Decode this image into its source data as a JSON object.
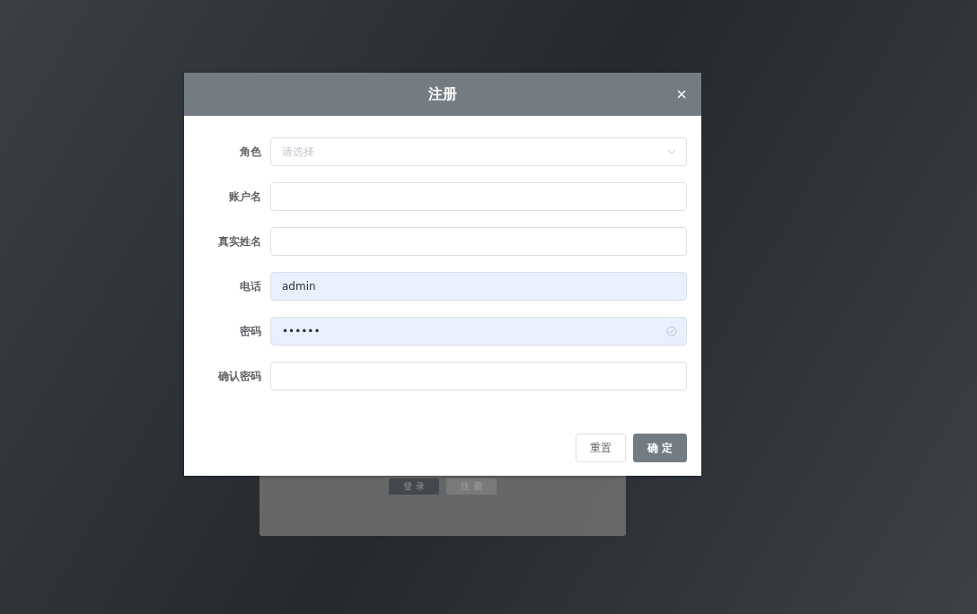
{
  "login_card": {
    "buttons": [
      {
        "label": "登 录",
        "kind": "primary"
      },
      {
        "label": "注 册",
        "kind": "secondary"
      }
    ]
  },
  "dialog": {
    "title": "注册",
    "fields": [
      {
        "label": "角色",
        "kind": "select",
        "placeholder": "请选择",
        "autofilled": false,
        "valid": false
      },
      {
        "label": "账户名",
        "kind": "text",
        "autofilled": false,
        "valid": false
      },
      {
        "label": "真实姓名",
        "kind": "text",
        "autofilled": false,
        "valid": false
      },
      {
        "label": "电话",
        "kind": "text",
        "value": "admin",
        "autofilled": true,
        "valid": false
      },
      {
        "label": "密码",
        "kind": "text",
        "value": "••••••",
        "autofilled": true,
        "valid": true
      },
      {
        "label": "确认密码",
        "kind": "text",
        "autofilled": false,
        "valid": false
      }
    ],
    "buttons": [
      {
        "label": "重置",
        "kind": "secondary"
      },
      {
        "label": "确 定",
        "kind": "primary"
      }
    ]
  }
}
